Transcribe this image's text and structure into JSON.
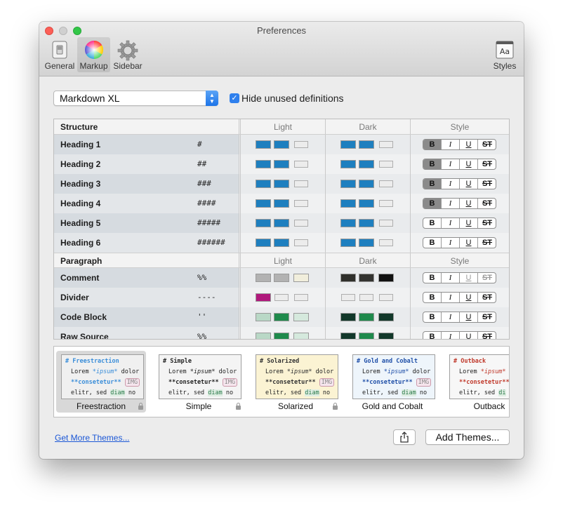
{
  "window": {
    "title": "Preferences",
    "toolbar": [
      {
        "label": "General",
        "icon": "switch-icon"
      },
      {
        "label": "Markup",
        "icon": "color-wheel-icon",
        "active": true
      },
      {
        "label": "Sidebar",
        "icon": "gear-icon"
      },
      {
        "label": "Styles",
        "icon": "font-book-icon"
      }
    ]
  },
  "markup": {
    "flavor": "Markdown XL",
    "hide_unused_label": "Hide unused definitions",
    "hide_unused_checked": true
  },
  "table": {
    "col_light": "Light",
    "col_dark": "Dark",
    "col_style": "Style",
    "structure_label": "Structure",
    "paragraph_label": "Paragraph",
    "style_buttons": [
      "B",
      "I",
      "U",
      "ST"
    ],
    "structure": [
      {
        "name": "Heading 1",
        "syntax": "#",
        "bold_on": true
      },
      {
        "name": "Heading 2",
        "syntax": "##",
        "bold_on": true
      },
      {
        "name": "Heading 3",
        "syntax": "###",
        "bold_on": true
      },
      {
        "name": "Heading 4",
        "syntax": "####",
        "bold_on": true
      },
      {
        "name": "Heading 5",
        "syntax": "#####",
        "bold_on": false
      },
      {
        "name": "Heading 6",
        "syntax": "######",
        "bold_on": false
      }
    ],
    "paragraph": [
      {
        "name": "Comment",
        "syntax": "%%"
      },
      {
        "name": "Divider",
        "syntax": "----"
      },
      {
        "name": "Code Block",
        "syntax": "''"
      },
      {
        "name": "Raw Source",
        "syntax": "%%"
      }
    ],
    "colors": {
      "blue": "#1e7fbf",
      "gray1": "#b2b2b2",
      "cream": "#f1eedc",
      "magenta": "#b0197c",
      "mint": "#b9d8c6",
      "green": "#1f8a4c",
      "pale_green": "#d5e9dd",
      "dark1": "#2f2f2b",
      "dark2": "#333330",
      "black": "#111111",
      "dark_green": "#12382a"
    }
  },
  "themes": [
    {
      "name": "Freestraction",
      "selected": true,
      "locked": true,
      "header": "# Freestraction",
      "line1a": "Lorem ",
      "line1b": "*ipsum*",
      "line1c": " dolor",
      "line2": "**consetetur**",
      "tag": "IMG",
      "line3a": "elitr, sed ",
      "line3b": "diam",
      "line3c": " no",
      "bg": "#f0f0f0",
      "accent": "#3b8ed9"
    },
    {
      "name": "Simple",
      "selected": false,
      "locked": true,
      "header": "# Simple",
      "line1a": "Lorem ",
      "line1b": "*ipsum*",
      "line1c": " dolor",
      "line2": "**consetetur**",
      "tag": "IMG",
      "line3a": "elitr, sed ",
      "line3b": "diam",
      "line3c": " no",
      "bg": "#f4f4f4",
      "accent": "#222222"
    },
    {
      "name": "Solarized",
      "selected": false,
      "locked": true,
      "header": "# Solarized",
      "line1a": "Lorem ",
      "line1b": "*ipsum*",
      "line1c": " dolor",
      "line2": "**consetetur**",
      "tag": "IMG",
      "line3a": "elitr, sed ",
      "line3b": "diam",
      "line3c": " no",
      "bg": "#fbf3d3",
      "accent": "#333333"
    },
    {
      "name": "Gold and Cobalt",
      "selected": false,
      "locked": false,
      "header": "# Gold and Cobalt",
      "line1a": "Lorem ",
      "line1b": "*ipsum*",
      "line1c": " dolor",
      "line2": "**consetetur**",
      "tag": "IMG",
      "line3a": "elitr, sed ",
      "line3b": "diam",
      "line3c": " no",
      "bg": "#eef5fb",
      "accent": "#1f4fa8"
    },
    {
      "name": "Outback",
      "selected": false,
      "locked": false,
      "header": "# Outback",
      "line1a": "Lorem ",
      "line1b": "*ipsum*",
      "line1c": "",
      "line2": "**consetetur**",
      "tag": "",
      "line3a": "elitr, sed ",
      "line3b": "di",
      "line3c": "",
      "bg": "#f7f7f7",
      "accent": "#c0392b"
    }
  ],
  "footer": {
    "get_more": "Get More Themes...",
    "add_themes": "Add Themes..."
  }
}
